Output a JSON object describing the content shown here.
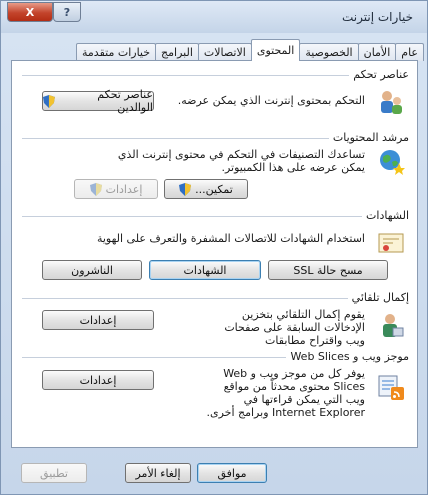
{
  "window": {
    "title": "خيارات إنترنت",
    "help_label": "?",
    "close_label": "X"
  },
  "tabs": [
    {
      "label": "عام"
    },
    {
      "label": "الأمان"
    },
    {
      "label": "الخصوصية"
    },
    {
      "label": "المحتوى"
    },
    {
      "label": "الاتصالات"
    },
    {
      "label": "البرامج"
    },
    {
      "label": "خيارات متقدمة"
    }
  ],
  "active_tab": "المحتوى",
  "parental": {
    "title": "عناصر تحكم",
    "desc": "التحكم بمحتوى إنترنت الذي يمكن عرضه.",
    "button": "عناصر تحكم الوالدين"
  },
  "advisor": {
    "title": "مرشد المحتويات",
    "desc": "تساعدك التصنيفات في التحكم في محتوى إنترنت الذي يمكن عرضه على هذا الكمبيوتر.",
    "enable_button": "تمكين...",
    "settings_button": "إعدادات"
  },
  "certificates": {
    "title": "الشهادات",
    "desc": "استخدام الشهادات للاتصالات المشفرة والتعرف على الهوية",
    "clear_ssl": "مسح حالة SSL",
    "certs": "الشهادات",
    "publishers": "الناشرون"
  },
  "autocomplete": {
    "title": "إكمال تلقائي",
    "desc": "يقوم إكمال التلقائي بتخزين الإدخالات السابقة على صفحات ويب واقتراح مطابقات",
    "settings_button": "إعدادات"
  },
  "feeds": {
    "title": "موجز ويب و Web Slices",
    "desc": "يوفر كل من موجز ويب و Web Slices محتوى محدثاً من مواقع ويب التي يمكن قراءتها في Internet Explorer وبرامج أخرى.",
    "settings_button": "إعدادات"
  },
  "footer": {
    "ok": "موافق",
    "cancel": "إلغاء الأمر",
    "apply": "تطبيق"
  }
}
